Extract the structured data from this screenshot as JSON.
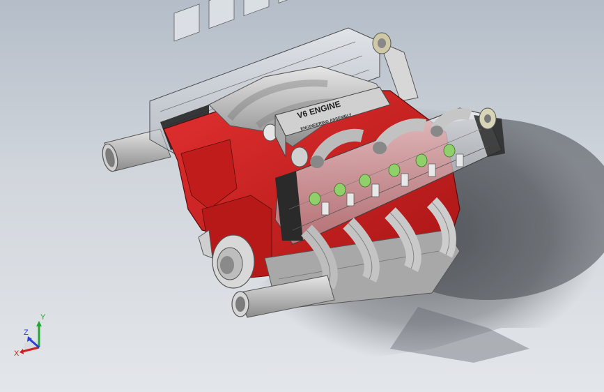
{
  "viewport": {
    "background_top": "#b4bdc8",
    "background_bottom": "#e3e6ea"
  },
  "model": {
    "name_plate": "V6 ENGINE",
    "sub_plate": "ENGINEERING ASSEMBLY",
    "block_color": "#d42222",
    "head_color": "#2b2b2b",
    "manifold_color": "#c8c8c8",
    "valve_color": "#8fd06a"
  },
  "triad": {
    "x_label": "X",
    "y_label": "Y",
    "z_label": "Z",
    "x_color": "#d12020",
    "y_color": "#22a830",
    "z_color": "#2a3fd8"
  }
}
